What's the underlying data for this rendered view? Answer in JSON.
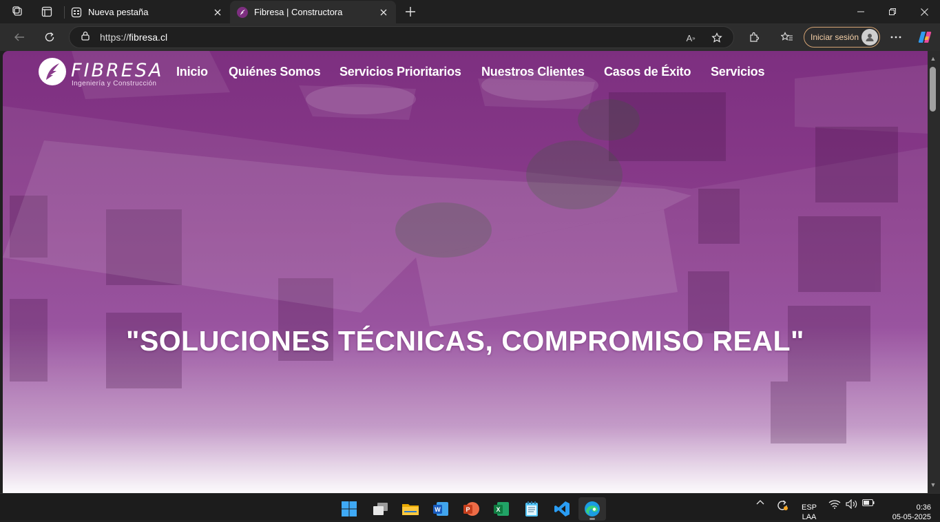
{
  "browser": {
    "tabs": [
      {
        "title": "Nueva pestaña",
        "favicon": "new-tab-icon"
      },
      {
        "title": "Fibresa | Constructora",
        "favicon": "fibresa-favicon"
      }
    ],
    "url_scheme": "https://",
    "url_host": "fibresa.cl",
    "signin_label": "Iniciar sesión",
    "accent": "#d4a373"
  },
  "site": {
    "logo_name": "FIBRESA",
    "logo_tagline": "Ingeniería y Construcción",
    "nav": [
      "Inicio",
      "Quiénes Somos",
      "Servicios Prioritarios",
      "Nuestros Clientes",
      "Casos de Éxito",
      "Servicios"
    ],
    "headline": "\"SOLUCIONES TÉCNICAS, COMPROMISO REAL\"",
    "brand_color": "#8a3d8c"
  },
  "taskbar": {
    "apps": [
      "windows-start",
      "task-view",
      "file-explorer",
      "word",
      "powerpoint",
      "excel",
      "notepad",
      "vscode",
      "edge"
    ],
    "language_top": "ESP",
    "language_bottom": "LAA",
    "time": "0:36",
    "date": "05-05-2025"
  }
}
